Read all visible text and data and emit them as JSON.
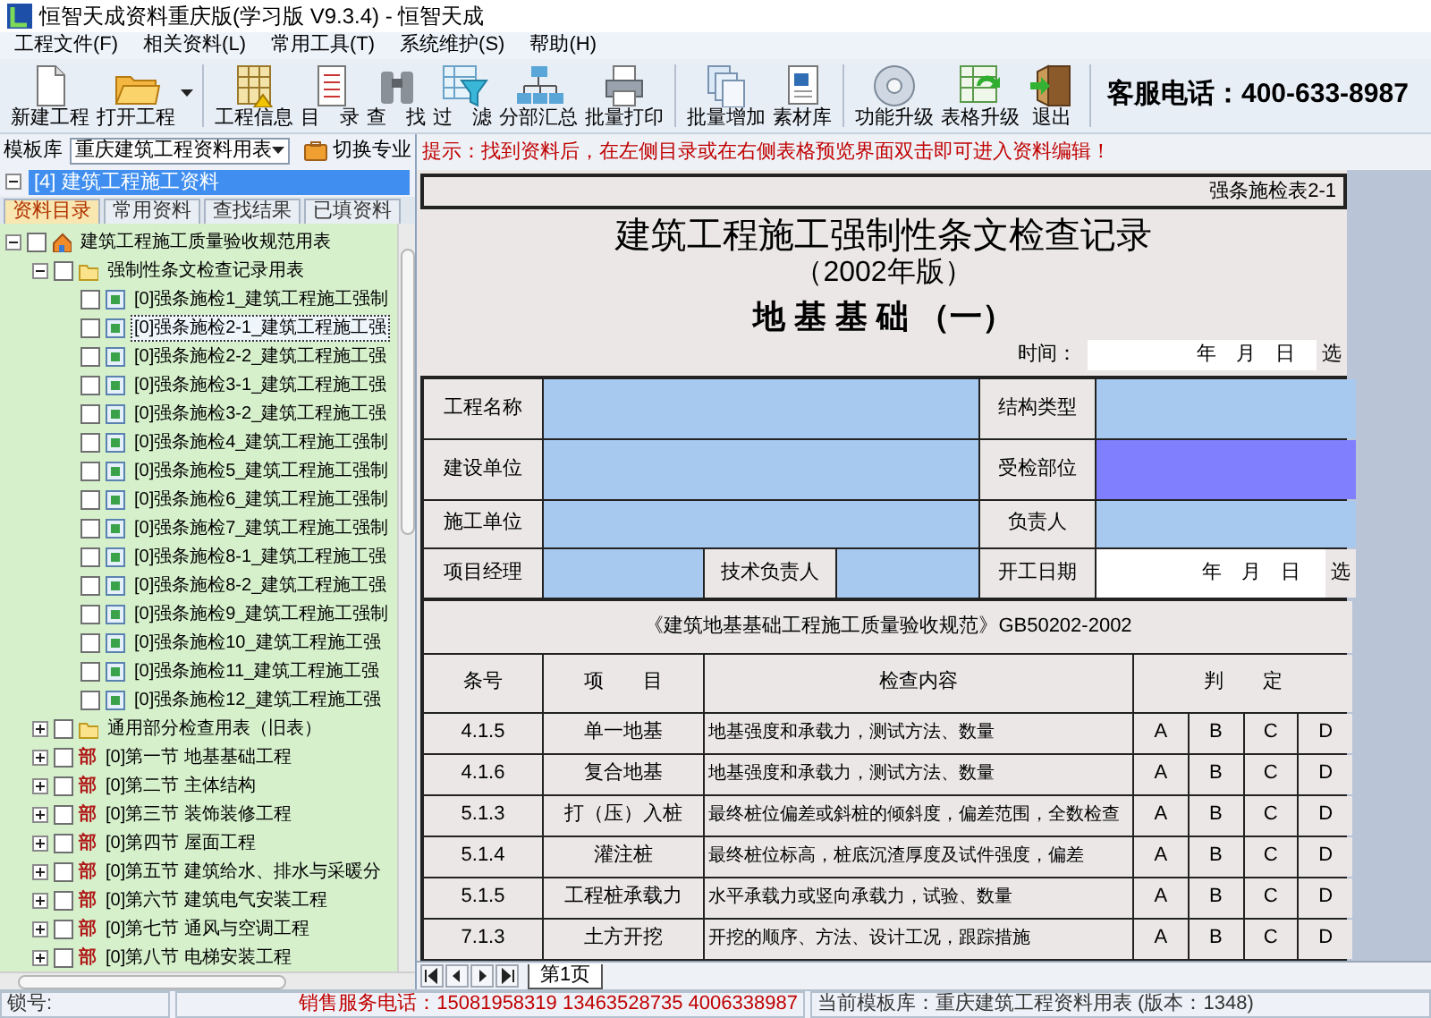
{
  "window": {
    "title": "恒智天成资料重庆版(学习版 V9.3.4) - 恒智天成"
  },
  "menu": [
    "工程文件(F)",
    "相关资料(L)",
    "常用工具(T)",
    "系统维护(S)",
    "帮助(H)"
  ],
  "toolbar": {
    "groups": [
      [
        {
          "label": "新建工程",
          "kind": "new"
        },
        {
          "label": "打开工程",
          "kind": "open",
          "dropdown": true
        }
      ],
      [
        {
          "label": "工程信息",
          "kind": "info"
        },
        {
          "label": "目　录",
          "kind": "list"
        },
        {
          "label": "查　找",
          "kind": "find"
        },
        {
          "label": "过　滤",
          "kind": "filter"
        },
        {
          "label": "分部汇总",
          "kind": "summary"
        },
        {
          "label": "批量打印",
          "kind": "print"
        }
      ],
      [
        {
          "label": "批量增加",
          "kind": "batch"
        },
        {
          "label": "素材库",
          "kind": "library"
        }
      ],
      [
        {
          "label": "功能升级",
          "kind": "upgrade"
        },
        {
          "label": "表格升级",
          "kind": "refresh"
        },
        {
          "label": "退出",
          "kind": "exit"
        }
      ]
    ],
    "hotline": "客服电话：400-633-8987"
  },
  "template_bar": {
    "label": "模板库",
    "value": "重庆建筑工程资料用表",
    "switch_button": "切换专业"
  },
  "project": {
    "label": "[4] 建筑工程施工资料",
    "expanded": true
  },
  "tabs": [
    {
      "label": "资料目录",
      "selected": true
    },
    {
      "label": "常用资料",
      "selected": false
    },
    {
      "label": "查找结果",
      "selected": false
    },
    {
      "label": "已填资料",
      "selected": false
    }
  ],
  "tree": [
    {
      "kind": "root",
      "label": "建筑工程施工质量验收规范用表",
      "expanded": true,
      "checked": false,
      "selected": false,
      "children": [
        {
          "kind": "folder",
          "label": "强制性条文检查记录用表",
          "expanded": true,
          "checked": false,
          "selected": false,
          "children": [
            {
              "kind": "form",
              "label": "[0]强条施检1_建筑工程施工强制",
              "checked": false,
              "selected": false
            },
            {
              "kind": "form",
              "label": "[0]强条施检2-1_建筑工程施工强",
              "checked": false,
              "selected": true
            },
            {
              "kind": "form",
              "label": "[0]强条施检2-2_建筑工程施工强",
              "checked": false,
              "selected": false
            },
            {
              "kind": "form",
              "label": "[0]强条施检3-1_建筑工程施工强",
              "checked": false,
              "selected": false
            },
            {
              "kind": "form",
              "label": "[0]强条施检3-2_建筑工程施工强",
              "checked": false,
              "selected": false
            },
            {
              "kind": "form",
              "label": "[0]强条施检4_建筑工程施工强制",
              "checked": false,
              "selected": false
            },
            {
              "kind": "form",
              "label": "[0]强条施检5_建筑工程施工强制",
              "checked": false,
              "selected": false
            },
            {
              "kind": "form",
              "label": "[0]强条施检6_建筑工程施工强制",
              "checked": false,
              "selected": false
            },
            {
              "kind": "form",
              "label": "[0]强条施检7_建筑工程施工强制",
              "checked": false,
              "selected": false
            },
            {
              "kind": "form",
              "label": "[0]强条施检8-1_建筑工程施工强",
              "checked": false,
              "selected": false
            },
            {
              "kind": "form",
              "label": "[0]强条施检8-2_建筑工程施工强",
              "checked": false,
              "selected": false
            },
            {
              "kind": "form",
              "label": "[0]强条施检9_建筑工程施工强制",
              "checked": false,
              "selected": false
            },
            {
              "kind": "form",
              "label": "[0]强条施检10_建筑工程施工强",
              "checked": false,
              "selected": false
            },
            {
              "kind": "form",
              "label": "[0]强条施检11_建筑工程施工强",
              "checked": false,
              "selected": false
            },
            {
              "kind": "form",
              "label": "[0]强条施检12_建筑工程施工强",
              "checked": false,
              "selected": false
            }
          ]
        },
        {
          "kind": "folder",
          "label": "通用部分检查用表（旧表）",
          "expanded": false,
          "checked": false,
          "selected": false
        },
        {
          "kind": "section",
          "mark": "部",
          "label": "[0]第一节 地基基础工程",
          "expanded": false,
          "checked": false,
          "selected": false
        },
        {
          "kind": "section",
          "mark": "部",
          "label": "[0]第二节 主体结构",
          "expanded": false,
          "checked": false,
          "selected": false
        },
        {
          "kind": "section",
          "mark": "部",
          "label": "[0]第三节 装饰装修工程",
          "expanded": false,
          "checked": false,
          "selected": false
        },
        {
          "kind": "section",
          "mark": "部",
          "label": "[0]第四节 屋面工程",
          "expanded": false,
          "checked": false,
          "selected": false
        },
        {
          "kind": "section",
          "mark": "部",
          "label": "[0]第五节 建筑给水、排水与采暖分",
          "expanded": false,
          "checked": false,
          "selected": false
        },
        {
          "kind": "section",
          "mark": "部",
          "label": "[0]第六节 建筑电气安装工程",
          "expanded": false,
          "checked": false,
          "selected": false
        },
        {
          "kind": "section",
          "mark": "部",
          "label": "[0]第七节 通风与空调工程",
          "expanded": false,
          "checked": false,
          "selected": false
        },
        {
          "kind": "section",
          "mark": "部",
          "label": "[0]第八节 电梯安装工程",
          "expanded": false,
          "checked": false,
          "selected": false
        }
      ]
    }
  ],
  "hint": "提示：找到资料后，在左侧目录或在右侧表格预览界面双击即可进入资料编辑！",
  "sheet": {
    "code": "强条施检表2-1",
    "title": "建筑工程施工强制性条文检查记录",
    "subtitle": "（2002年版）",
    "heading": "地 基 基 础 （一）",
    "time_label": "时间：",
    "time_value": "年　月　日",
    "time_button": "选",
    "info_rows": [
      [
        {
          "kind": "label",
          "text": "工程名称"
        },
        {
          "kind": "field",
          "selected": false
        },
        {
          "kind": "label",
          "text": "结构类型"
        },
        {
          "kind": "field",
          "selected": false
        }
      ],
      [
        {
          "kind": "label",
          "text": "建设单位"
        },
        {
          "kind": "field",
          "selected": false
        },
        {
          "kind": "label",
          "text": "受检部位"
        },
        {
          "kind": "field",
          "selected": true
        }
      ],
      [
        {
          "kind": "label",
          "text": "施工单位"
        },
        {
          "kind": "field",
          "selected": false
        },
        {
          "kind": "label",
          "text": "负责人"
        },
        {
          "kind": "field",
          "selected": false
        }
      ],
      [
        {
          "kind": "label",
          "text": "项目经理"
        },
        {
          "kind": "field",
          "selected": false
        },
        {
          "kind": "label",
          "text": "技术负责人"
        },
        {
          "kind": "field",
          "selected": false
        },
        {
          "kind": "label",
          "text": "开工日期"
        },
        {
          "kind": "date",
          "text": "年　月　日",
          "button": "选"
        }
      ]
    ],
    "standard": "《建筑地基基础工程施工质量验收规范》GB50202-2002",
    "columns": [
      "条号",
      "项　　目",
      "检查内容",
      "判　　定"
    ],
    "rows": [
      {
        "clause": "4.1.5",
        "item": "单一地基",
        "content": "地基强度和承载力，测试方法、数量",
        "grades": [
          "A",
          "B",
          "C",
          "D"
        ]
      },
      {
        "clause": "4.1.6",
        "item": "复合地基",
        "content": "地基强度和承载力，测试方法、数量",
        "grades": [
          "A",
          "B",
          "C",
          "D"
        ]
      },
      {
        "clause": "5.1.3",
        "item": "打（压）入桩",
        "content": "最终桩位偏差或斜桩的倾斜度，偏差范围，全数检查",
        "grades": [
          "A",
          "B",
          "C",
          "D"
        ]
      },
      {
        "clause": "5.1.4",
        "item": "灌注桩",
        "content": "最终桩位标高，桩底沉渣厚度及试件强度，偏差",
        "grades": [
          "A",
          "B",
          "C",
          "D"
        ]
      },
      {
        "clause": "5.1.5",
        "item": "工程桩承载力",
        "content": "水平承载力或竖向承载力，试验、数量",
        "grades": [
          "A",
          "B",
          "C",
          "D"
        ]
      },
      {
        "clause": "7.1.3",
        "item": "土方开挖",
        "content": "开挖的顺序、方法、设计工况，跟踪措施",
        "grades": [
          "A",
          "B",
          "C",
          "D"
        ]
      }
    ]
  },
  "sheet_tabs": [
    {
      "label": "第1页",
      "selected": true
    }
  ],
  "status_bar": {
    "lock": "锁号:",
    "sales": "销售服务电话：15081958319 13463528735 4006338987",
    "template": "当前模板库：重庆建筑工程资料用表 (版本：1348)"
  }
}
